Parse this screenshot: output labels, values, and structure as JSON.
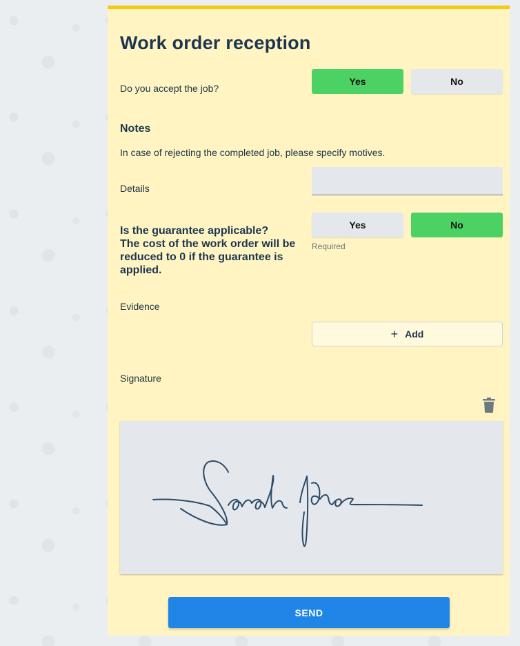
{
  "form": {
    "title": "Work order reception",
    "accept_job": {
      "question": "Do you accept the job?",
      "options": [
        "Yes",
        "No"
      ],
      "selected": "Yes"
    },
    "notes": {
      "heading": "Notes",
      "description": "In case of rejecting the completed job, please specify motives.",
      "details_label": "Details",
      "details_value": ""
    },
    "guarantee": {
      "question_line1": "Is the guarantee applicable?",
      "question_line2": "The cost of the work order will be reduced to 0 if the guarantee is applied.",
      "options": [
        "Yes",
        "No"
      ],
      "selected": "No",
      "helper": "Required"
    },
    "evidence": {
      "label": "Evidence",
      "add_label": "Add"
    },
    "signature": {
      "label": "Signature",
      "signed_name": "Sarah Jones"
    },
    "send_label": "SEND"
  },
  "icons": {
    "add": "plus-icon",
    "delete": "trash-icon"
  },
  "colors": {
    "card_background": "#fff4c2",
    "card_top_border": "#f6c915",
    "selected_option": "#4cd264",
    "unselected_option": "#e4e8ec",
    "primary_button": "#1f86e8",
    "heading_text": "#1c3651"
  }
}
